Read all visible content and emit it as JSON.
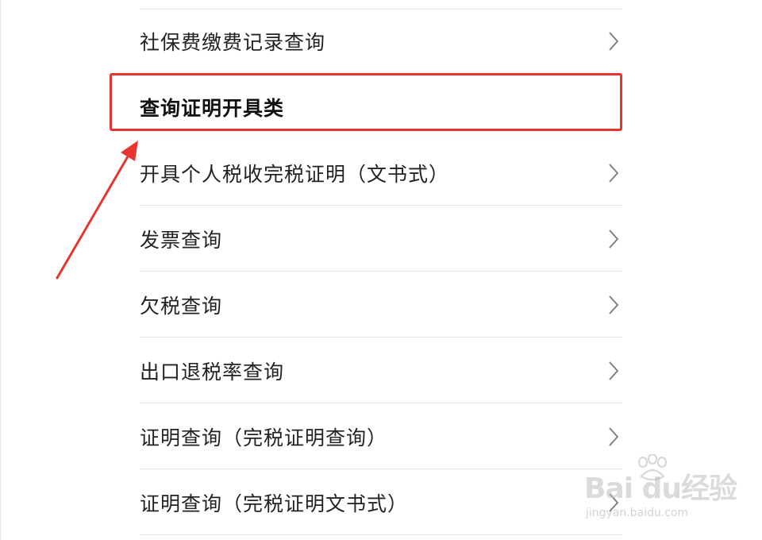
{
  "list": {
    "rows_before": [
      {
        "label": "社保费缴费记录查询"
      }
    ],
    "section_header": "查询证明开具类",
    "rows_after": [
      {
        "label": "开具个人税收完税证明（文书式）"
      },
      {
        "label": "发票查询"
      },
      {
        "label": "欠税查询"
      },
      {
        "label": "出口退税率查询"
      },
      {
        "label": "证明查询（完税证明查询）"
      },
      {
        "label": "证明查询（完税证明文书式）"
      }
    ]
  },
  "annotation": {
    "highlight_color": "#e8342f",
    "arrow_color": "#e8342f"
  },
  "watermark": {
    "logo_text": "Bai du经验",
    "url": "jingyan.baidu.com"
  },
  "icons": {
    "row_chevron": "chevron-right-icon"
  }
}
